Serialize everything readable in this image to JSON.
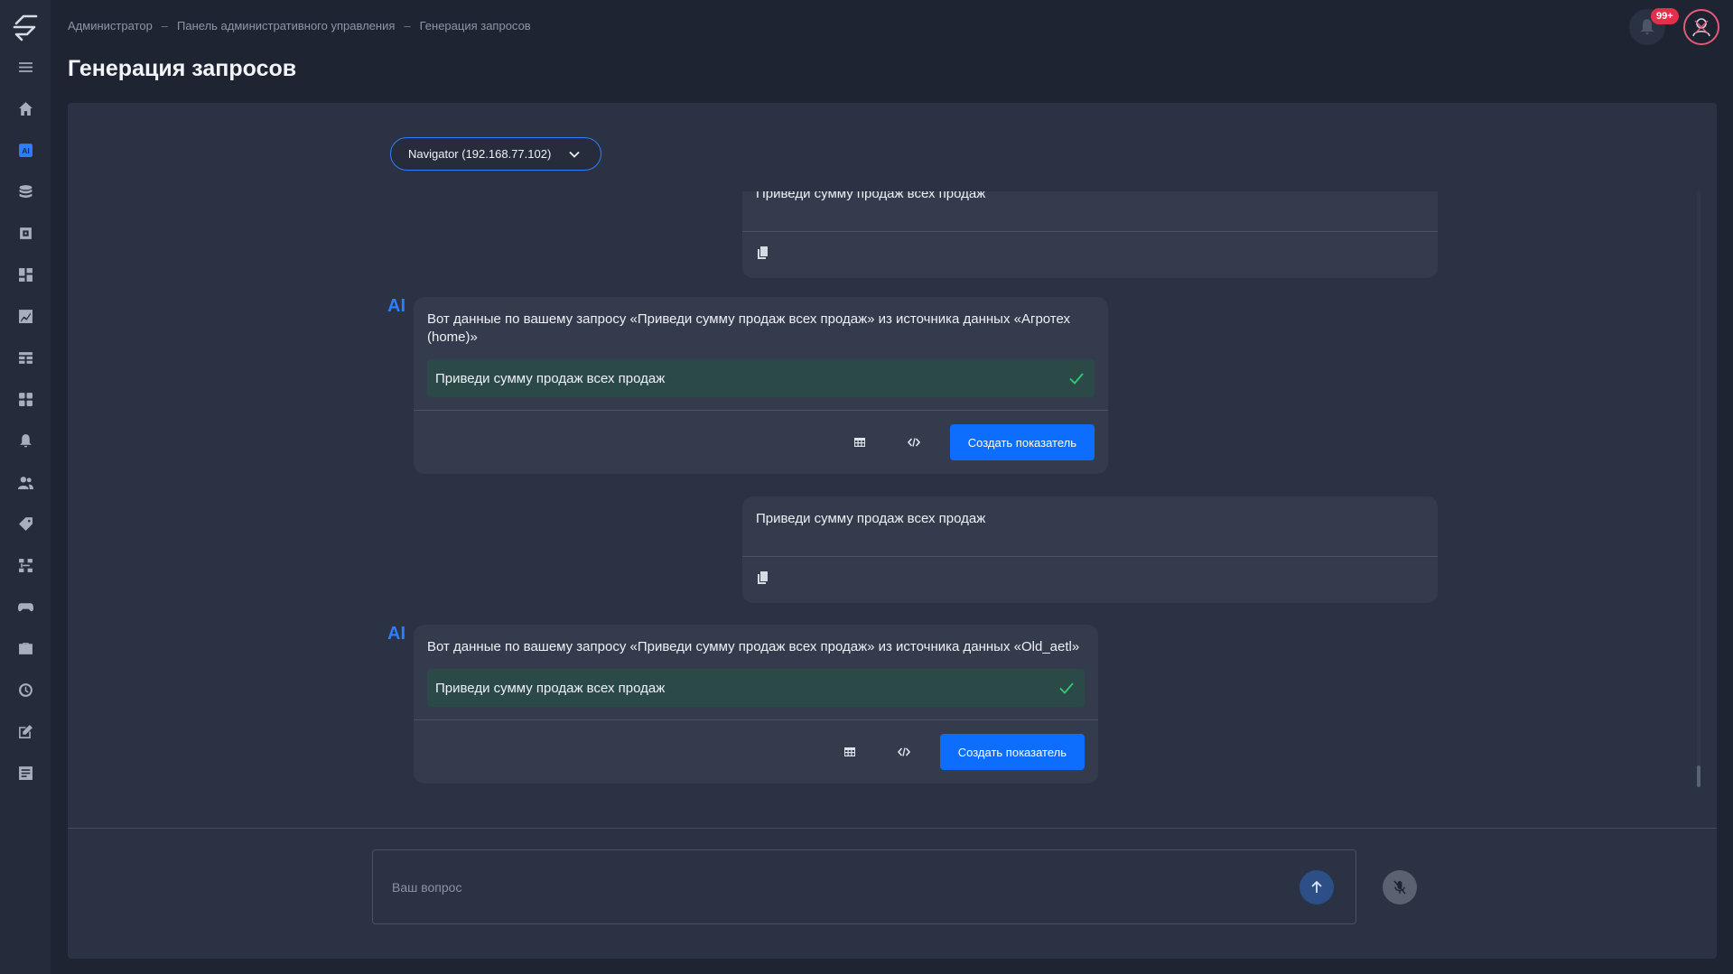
{
  "breadcrumb": {
    "items": [
      "Администратор",
      "Панель административного управления",
      "Генерация запросов"
    ],
    "separator": "–"
  },
  "page": {
    "title": "Генерация запросов"
  },
  "notifications": {
    "badge": "99+"
  },
  "source_select": {
    "value": "Navigator (192.168.77.102)"
  },
  "sidebar": {
    "icons": [
      "menu-icon",
      "home-icon",
      "ai-icon",
      "database-icon",
      "module-icon",
      "dashboard-icon",
      "chart-icon",
      "table-icon",
      "widgets-icon",
      "alerts-icon",
      "users-icon",
      "tag-icon",
      "schema-icon",
      "gamepad-icon",
      "briefcase-icon",
      "history-icon",
      "edit-icon",
      "report-icon"
    ],
    "active": "ai-icon"
  },
  "messages": [
    {
      "role": "user",
      "text": "Приведи сумму продаж всех продаж"
    },
    {
      "role": "ai",
      "label": "AI",
      "intro": "Вот данные по вашему запросу «Приведи сумму продаж всех продаж» из источника данных «Агротех (home)»",
      "query": "Приведи сумму продаж всех продаж",
      "button": "Создать показатель"
    },
    {
      "role": "user",
      "text": "Приведи сумму продаж всех продаж"
    },
    {
      "role": "ai",
      "label": "AI",
      "intro": "Вот данные по вашему запросу «Приведи сумму продаж всех продаж» из источника данных «Old_aetl»",
      "query": "Приведи сумму продаж всех продаж",
      "button": "Создать показатель"
    }
  ],
  "composer": {
    "placeholder": "Ваш вопрос"
  },
  "colors": {
    "accent": "#2f7dff",
    "button": "#0d6efd",
    "success": "#2ecc71",
    "query_bg": "#2b4a47"
  }
}
